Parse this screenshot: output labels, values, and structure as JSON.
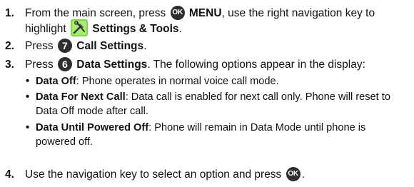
{
  "steps": [
    {
      "num": "1.",
      "line1_pre": "From the main screen, press ",
      "ok_icon_text": "OK",
      "menu_label": "MENU",
      "line1_post": ", use the right navigation key to",
      "line2_pre": "highlight ",
      "settings_label": "Settings & Tools",
      "line2_post": "."
    },
    {
      "num": "2.",
      "pre": "Press ",
      "key_digit": "7",
      "label": "Call Settings",
      "post": "."
    },
    {
      "num": "3.",
      "pre": "Press ",
      "key_digit": "6",
      "label": "Data Settings",
      "post": ". The following options appear in the display:"
    },
    {
      "num": "4.",
      "pre": "Use the navigation key to select an option and press ",
      "ok_icon_text": "OK",
      "post": "."
    }
  ],
  "options": [
    {
      "title": "Data Off",
      "desc_line1": ": Phone operates in normal voice call mode."
    },
    {
      "title": "Data For Next Call",
      "desc_line1": ": Data call is enabled for next call only. Phone will reset to",
      "desc_line2": "Data Off mode after call."
    },
    {
      "title": "Data Until Powered Off",
      "desc_line1": ": Phone will remain in Data Mode until phone is",
      "desc_line2": "powered off."
    }
  ],
  "bullet_char": "•",
  "colors": {
    "text": "#111111",
    "key_icon_bg": "#2e2e2e",
    "key_icon_fg": "#ffffff",
    "tools_icon_bg": "#7fd84a"
  },
  "icons": {
    "ok_key": "ok-key-icon",
    "settings_tools": "settings-tools-icon",
    "digit_key": "number-key-icon"
  }
}
